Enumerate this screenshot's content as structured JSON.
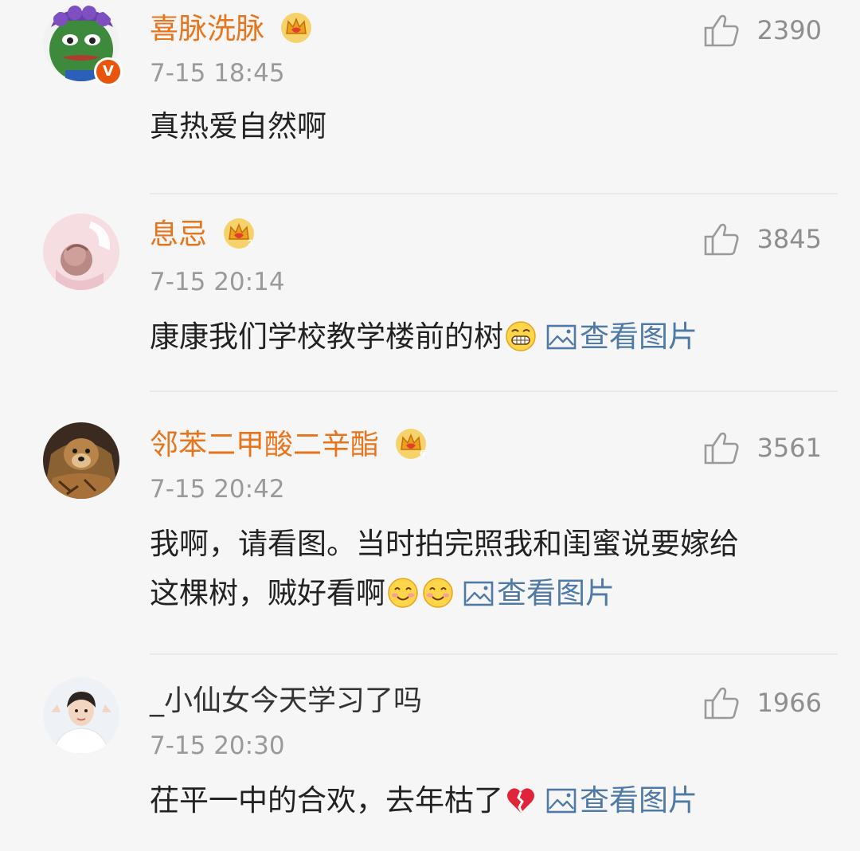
{
  "comments": [
    {
      "name": "喜脉洗脉",
      "time": "7-15 18:45",
      "likes": "2390",
      "text": "真热爱自然啊",
      "verified": true,
      "name_color": "#e8741c"
    },
    {
      "name": "息忌",
      "time": "7-15 20:14",
      "likes": "3845",
      "text": "康康我们学校教学楼前的树",
      "emojis": [
        "grin-emoji"
      ],
      "view_pictures": "查看图片",
      "name_color": "#e8741c"
    },
    {
      "name": "邻苯二甲酸二辛酯",
      "time": "7-15 20:42",
      "likes": "3561",
      "text_line1": "我啊，请看图。当时拍完照我和闺蜜说要嫁给",
      "text_line2": "这棵树，贼好看啊",
      "emojis": [
        "smile-emoji",
        "smile-emoji"
      ],
      "view_pictures": "查看图片",
      "name_color": "#e8741c"
    },
    {
      "name": "_小仙女今天学习了吗",
      "time": "7-15 20:30",
      "likes": "1966",
      "text": "茌平一中的合欢，去年枯了",
      "emojis": [
        "broken-heart-emoji"
      ],
      "view_pictures": "查看图片",
      "name_color": "#333333"
    }
  ],
  "icons": {
    "like": "thumbs-up-icon",
    "picture": "picture-icon",
    "crown": "vip-crown-icon",
    "verified": "verified-v-badge"
  },
  "verified_badge_text": "V"
}
